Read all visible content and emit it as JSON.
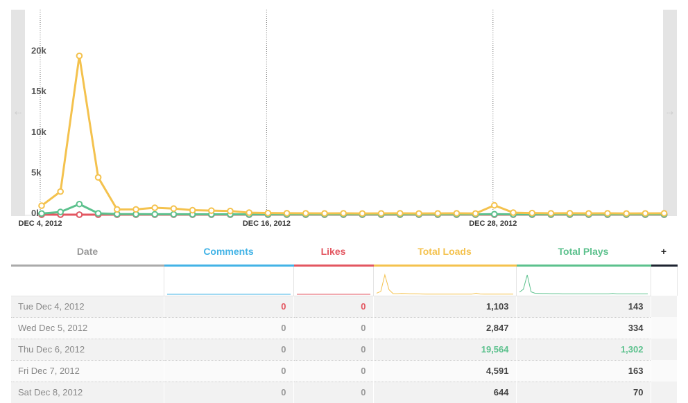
{
  "chart_data": {
    "type": "line",
    "x": [
      "2012-12-04",
      "2012-12-05",
      "2012-12-06",
      "2012-12-07",
      "2012-12-08",
      "2012-12-09",
      "2012-12-10",
      "2012-12-11",
      "2012-12-12",
      "2012-12-13",
      "2012-12-14",
      "2012-12-15",
      "2012-12-16",
      "2012-12-17",
      "2012-12-18",
      "2012-12-19",
      "2012-12-20",
      "2012-12-21",
      "2012-12-22",
      "2012-12-23",
      "2012-12-24",
      "2012-12-25",
      "2012-12-26",
      "2012-12-27",
      "2012-12-28",
      "2012-12-29",
      "2012-12-30",
      "2012-12-31",
      "2013-01-01",
      "2013-01-02",
      "2013-01-03",
      "2013-01-04",
      "2013-01-05",
      "2013-01-06"
    ],
    "x_tick_labels": [
      {
        "x": "2012-12-04",
        "label": "DEC 4, 2012"
      },
      {
        "x": "2012-12-16",
        "label": "DEC 16, 2012"
      },
      {
        "x": "2012-12-28",
        "label": "DEC 28, 2012"
      }
    ],
    "y_ticks": [
      {
        "value": 0,
        "label": "0k"
      },
      {
        "value": 5000,
        "label": "5k"
      },
      {
        "value": 10000,
        "label": "10k"
      },
      {
        "value": 15000,
        "label": "15k"
      },
      {
        "value": 20000,
        "label": "20k"
      }
    ],
    "ylim": [
      0,
      21500
    ],
    "grid": "vertical dotted lines at tick dates",
    "series": [
      {
        "name": "Total Loads",
        "color": "#f4c24e",
        "values": [
          1103,
          2847,
          19564,
          4591,
          644,
          650,
          850,
          750,
          550,
          500,
          450,
          250,
          200,
          180,
          170,
          160,
          170,
          150,
          160,
          170,
          150,
          160,
          170,
          150,
          1150,
          250,
          200,
          170,
          180,
          160,
          170,
          150,
          160,
          170
        ]
      },
      {
        "name": "Total Plays",
        "color": "#5cc18d",
        "values": [
          143,
          334,
          1302,
          163,
          70,
          60,
          50,
          50,
          40,
          40,
          40,
          30,
          30,
          30,
          30,
          30,
          30,
          30,
          30,
          30,
          30,
          30,
          30,
          30,
          60,
          30,
          30,
          30,
          30,
          30,
          30,
          30,
          30,
          30
        ]
      },
      {
        "name": "Likes",
        "color": "#e35660",
        "values": [
          0,
          0,
          0,
          0,
          0,
          0,
          0,
          0,
          0,
          0,
          0,
          0,
          0,
          0,
          0,
          0,
          0,
          0,
          0,
          0,
          0,
          0,
          0,
          0,
          0,
          0,
          0,
          0,
          0,
          0,
          0,
          0,
          0,
          0
        ]
      },
      {
        "name": "Comments",
        "color": "#42b3e6",
        "values": [
          0,
          0,
          0,
          0,
          0,
          0,
          0,
          0,
          0,
          0,
          0,
          0,
          0,
          0,
          0,
          0,
          0,
          0,
          0,
          0,
          0,
          0,
          0,
          0,
          0,
          0,
          0,
          0,
          0,
          0,
          0,
          0,
          0,
          0
        ]
      }
    ]
  },
  "nav": {
    "prev_icon": "⇠",
    "next_icon": "⇢"
  },
  "table": {
    "headers": {
      "date": "Date",
      "comments": "Comments",
      "likes": "Likes",
      "loads": "Total Loads",
      "plays": "Total Plays",
      "add": "+"
    },
    "rows": [
      {
        "date": "Tue Dec 4, 2012",
        "comments": "0",
        "likes": "0",
        "loads": "1,103",
        "plays": "143"
      },
      {
        "date": "Wed Dec 5, 2012",
        "comments": "0",
        "likes": "0",
        "loads": "2,847",
        "plays": "334"
      },
      {
        "date": "Thu Dec 6, 2012",
        "comments": "0",
        "likes": "0",
        "loads": "19,564",
        "plays": "1,302"
      },
      {
        "date": "Fri Dec 7, 2012",
        "comments": "0",
        "likes": "0",
        "loads": "4,591",
        "plays": "163"
      },
      {
        "date": "Sat Dec 8, 2012",
        "comments": "0",
        "likes": "0",
        "loads": "644",
        "plays": "70"
      }
    ]
  }
}
